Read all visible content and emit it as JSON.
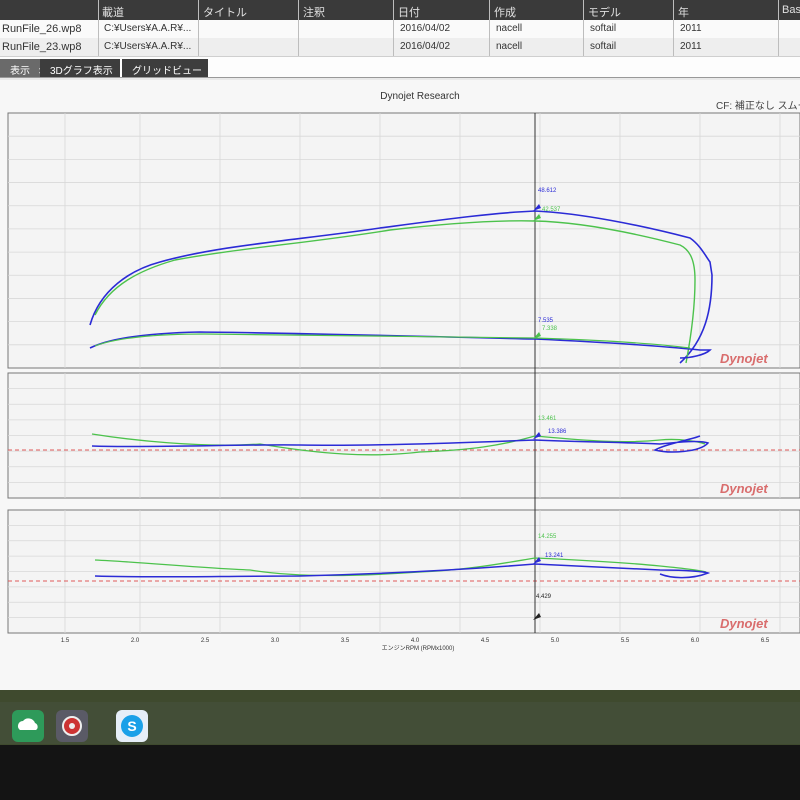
{
  "file_table": {
    "headers": [
      "",
      "載道",
      "タイトル",
      "注釈",
      "日付",
      "作成",
      "モデル",
      "年",
      "Base"
    ],
    "rows": [
      {
        "file": "RunFile_26.wp8",
        "path": "C:¥Users¥A.A.R¥...",
        "title": "",
        "note": "",
        "date": "2016/04/02",
        "author": "nacell",
        "model": "softail",
        "year": "2011"
      },
      {
        "file": "RunFile_23.wp8",
        "path": "C:¥Users¥A.A.R¥...",
        "title": "",
        "note": "",
        "date": "2016/04/02",
        "author": "nacell",
        "model": "softail",
        "year": "2011"
      }
    ]
  },
  "tabs": [
    {
      "label": "表示",
      "close": "✕",
      "active": true
    },
    {
      "label": "3Dグラフ表示",
      "active": false
    },
    {
      "label": "グリッドビュー",
      "active": false
    }
  ],
  "graph": {
    "title": "Dynojet Research",
    "cf_label": "CF: 補正なし スムー",
    "watermark": "Dynojet",
    "x_axis_label": "エンジンRPM (RPMx1000)",
    "x_ticks": [
      "1.5",
      "2.0",
      "2.5",
      "3.0",
      "3.5",
      "4.0",
      "4.5",
      "5.0",
      "5.5",
      "6.0",
      "6.5"
    ],
    "cursor_x": 4.429,
    "cursor_label": "4.429",
    "colors": {
      "blue": "#2b2bd6",
      "green": "#4cc24c",
      "red_dash": "#e05a5a"
    },
    "panel1_labels": {
      "blue_hp": "48.612",
      "green_hp": "42.537",
      "blue_tq": "7.535",
      "green_tq": "7.338"
    },
    "panel2_labels": {
      "green": "13.461",
      "blue": "13.386"
    },
    "panel3_labels": {
      "green": "14.255",
      "blue": "13.241"
    }
  },
  "taskbar": {
    "icons": [
      "cloud-icon",
      "settings-app-icon",
      "skype-icon"
    ]
  }
}
